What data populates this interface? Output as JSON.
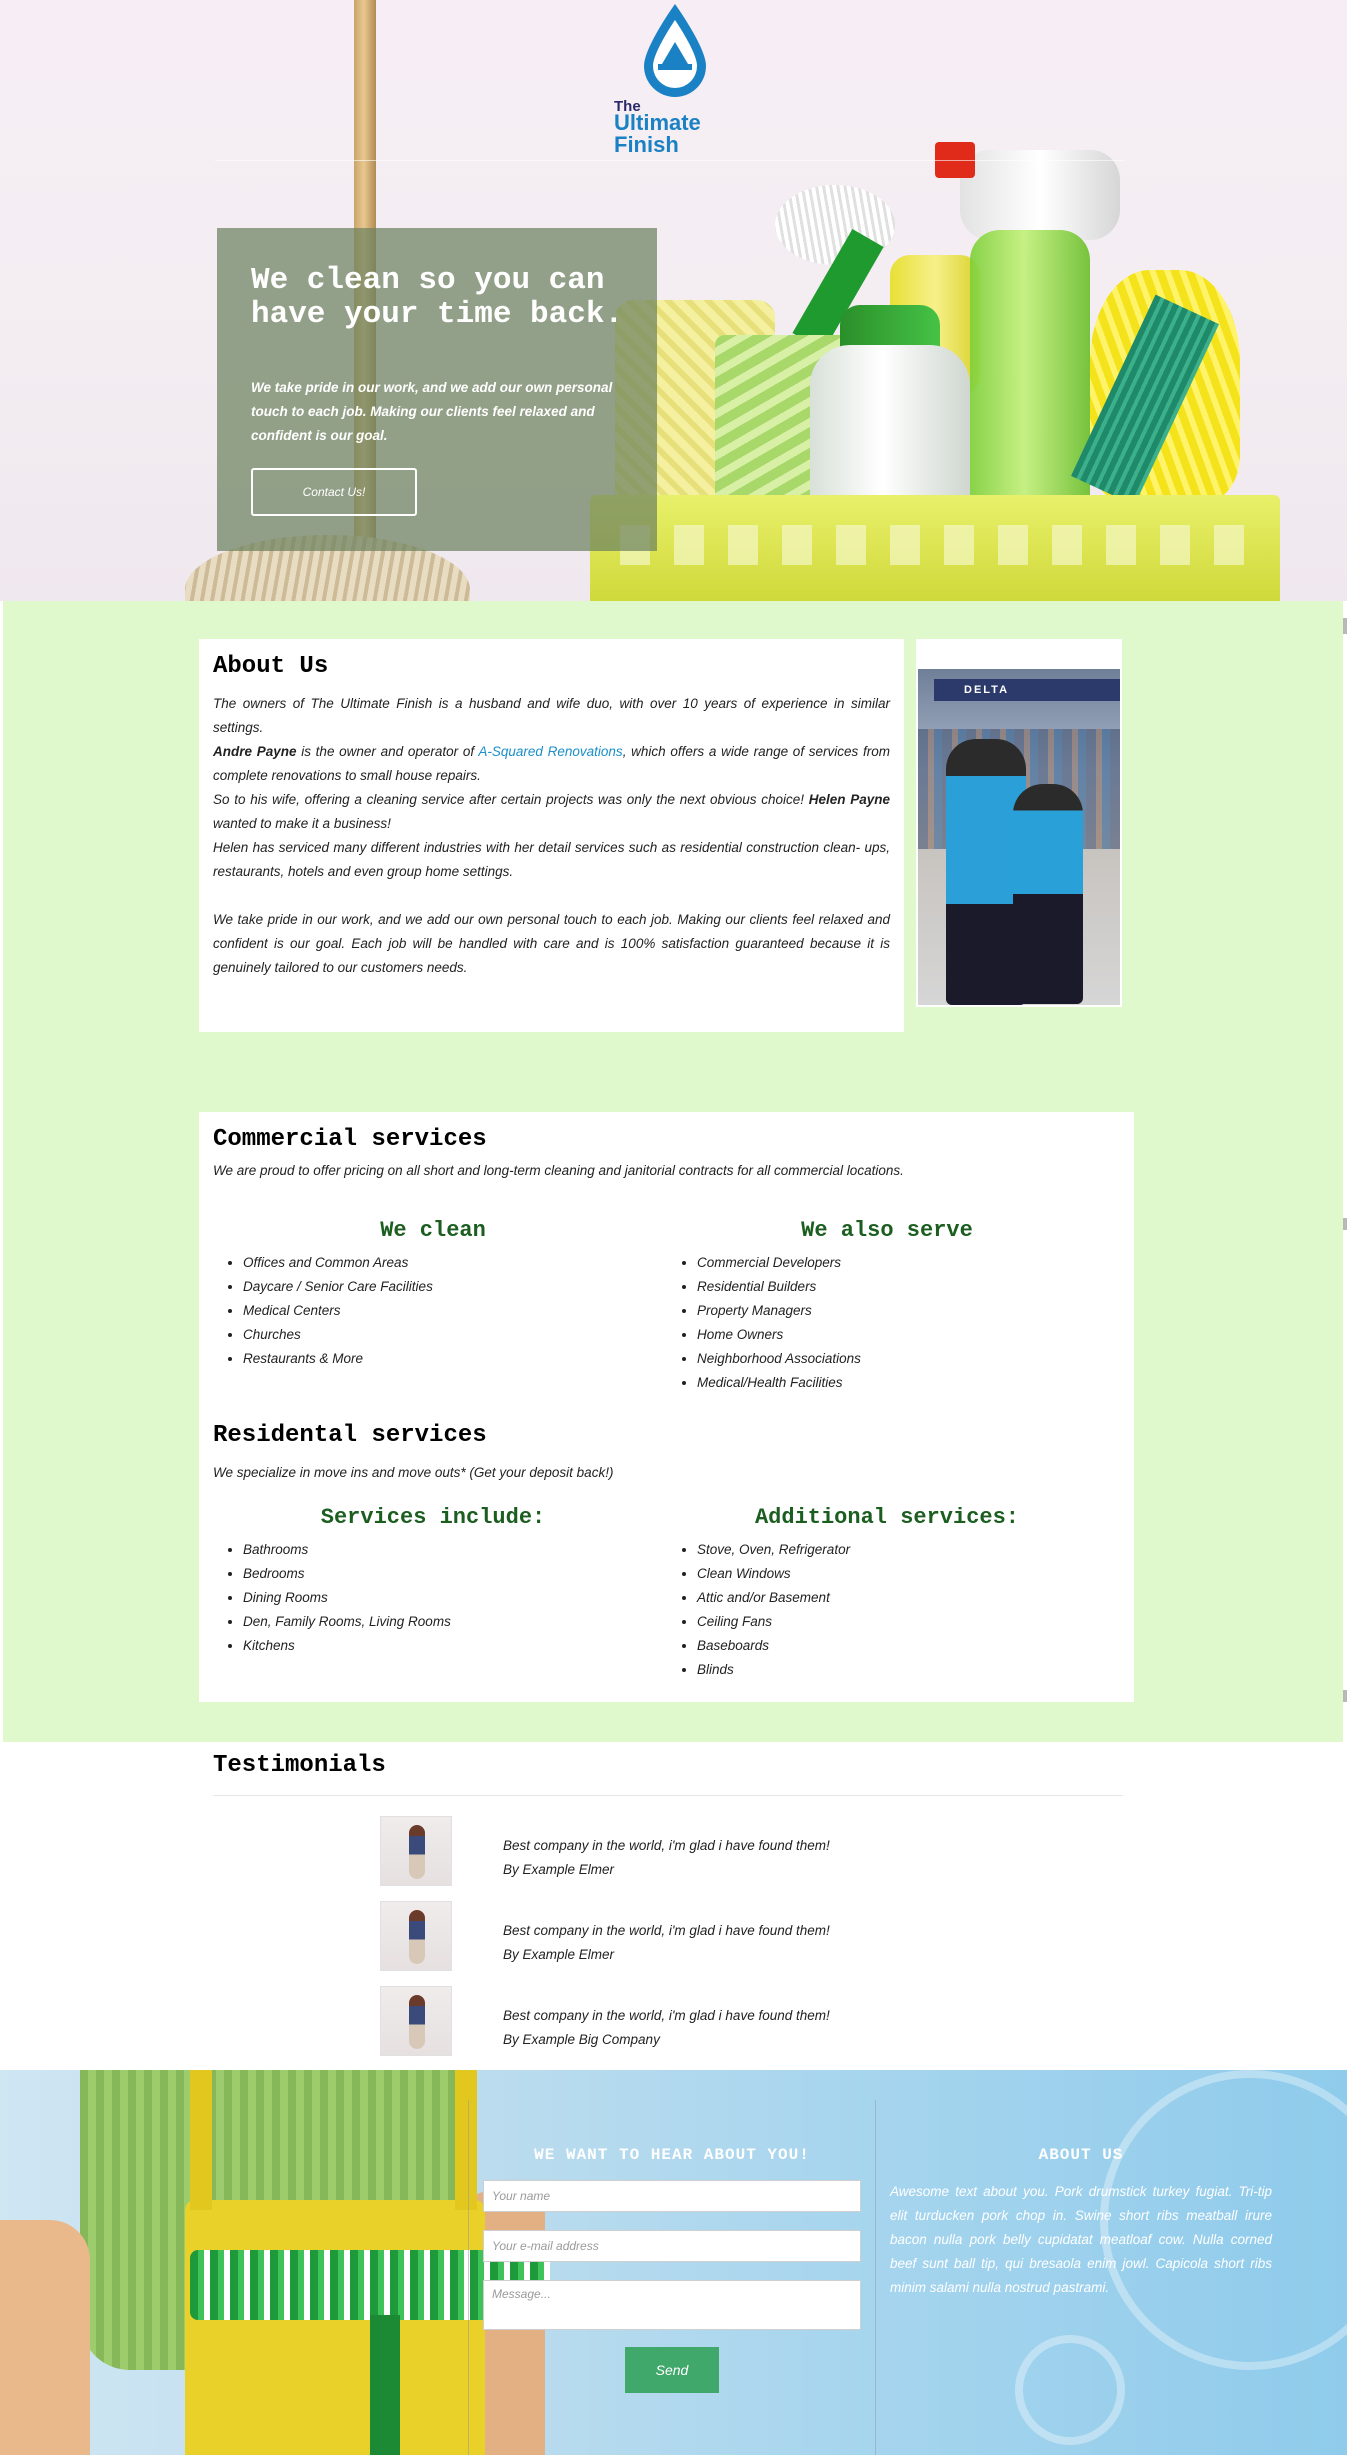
{
  "brand": {
    "line1": "The",
    "line2": "Ultimate",
    "line3": "Finish"
  },
  "hero": {
    "title": "We clean so you can have your time back.",
    "subtitle": "We take pride in our work, and we add our own personal touch to each job. Making our clients feel relaxed and confident is our goal.",
    "button": "Contact Us!"
  },
  "about": {
    "heading": "About Us",
    "p1": "The owners of The Ultimate Finish is a husband and wife duo, with over 10 years of experience in similar settings.",
    "p2_name": "Andre Payne",
    "p2_mid": " is the owner and operator of ",
    "p2_link": "A-Squared Renovations",
    "p2_end": ", which offers a wide range of services from complete renovations to small house repairs.",
    "p3_start": "So to his wife, offering a cleaning service after certain projects was only the next obvious choice! ",
    "p3_name": "Helen Payne",
    "p3_end": " wanted to make it a business!",
    "p4": "Helen has serviced many different industries with her detail services such as residential construction clean- ups, restaurants, hotels and even group home settings.",
    "p5": "We take pride in our work, and we add our own personal touch to each job. Making our clients feel relaxed and confident is our goal. Each job will be handled with care and is 100% satisfaction guaranteed because it is genuinely tailored to our customers needs.",
    "photo_sign": "DELTA"
  },
  "commercial": {
    "heading": "Commercial services",
    "intro": "We are proud to offer pricing on all short and long-term cleaning and janitorial contracts for all commercial locations.",
    "col1_title": "We clean",
    "col1": [
      "Offices and Common Areas",
      "Daycare / Senior Care Facilities",
      "Medical Centers",
      "Churches",
      "Restaurants & More"
    ],
    "col2_title": "We also serve",
    "col2": [
      "Commercial Developers",
      "Residential Builders",
      "Property Managers",
      "Home Owners",
      "Neighborhood Associations",
      "Medical/Health Facilities"
    ]
  },
  "residential": {
    "heading": "Residental services",
    "intro": "We specialize in move ins and move outs* (Get your deposit back!)",
    "col1_title": "Services include:",
    "col1": [
      "Bathrooms",
      "Bedrooms",
      "Dining Rooms",
      "Den, Family Rooms, Living Rooms",
      "Kitchens"
    ],
    "col2_title": "Additional services:",
    "col2": [
      "Stove, Oven, Refrigerator",
      "Clean Windows",
      "Attic and/or Basement",
      "Ceiling Fans",
      "Baseboards",
      "Blinds"
    ]
  },
  "testimonials": {
    "heading": "Testimonials",
    "items": [
      {
        "quote": "Best company in the world, i'm glad i have found them!",
        "author": "By Example Elmer"
      },
      {
        "quote": "Best company in the world, i'm glad i have found them!",
        "author": "By Example Elmer"
      },
      {
        "quote": "Best company in the world, i'm glad i have found them!",
        "author": "By Example Big Company"
      }
    ]
  },
  "footer": {
    "contact_title": "WE WANT TO HEAR ABOUT YOU!",
    "name_placeholder": "Your name",
    "email_placeholder": "Your e-mail address",
    "message_placeholder": "Message...",
    "send": "Send",
    "about_title": "ABOUT US",
    "about_text": "Awesome text about you.  Pork drumstick turkey fugiat. Tri-tip elit turducken pork chop in. Swine short ribs meatball irure bacon nulla pork belly cupidatat meatloaf cow. Nulla corned beef sunt ball tip, qui bresaola enim jowl. Capicola short ribs minim salami nulla nostrud pastrami."
  },
  "colors": {
    "green_bg": "#dff9cc",
    "heading_green": "#1b5e20",
    "link": "#1a8fc9",
    "send_button": "#3fa86a",
    "brand_blue": "#1a82c4"
  }
}
